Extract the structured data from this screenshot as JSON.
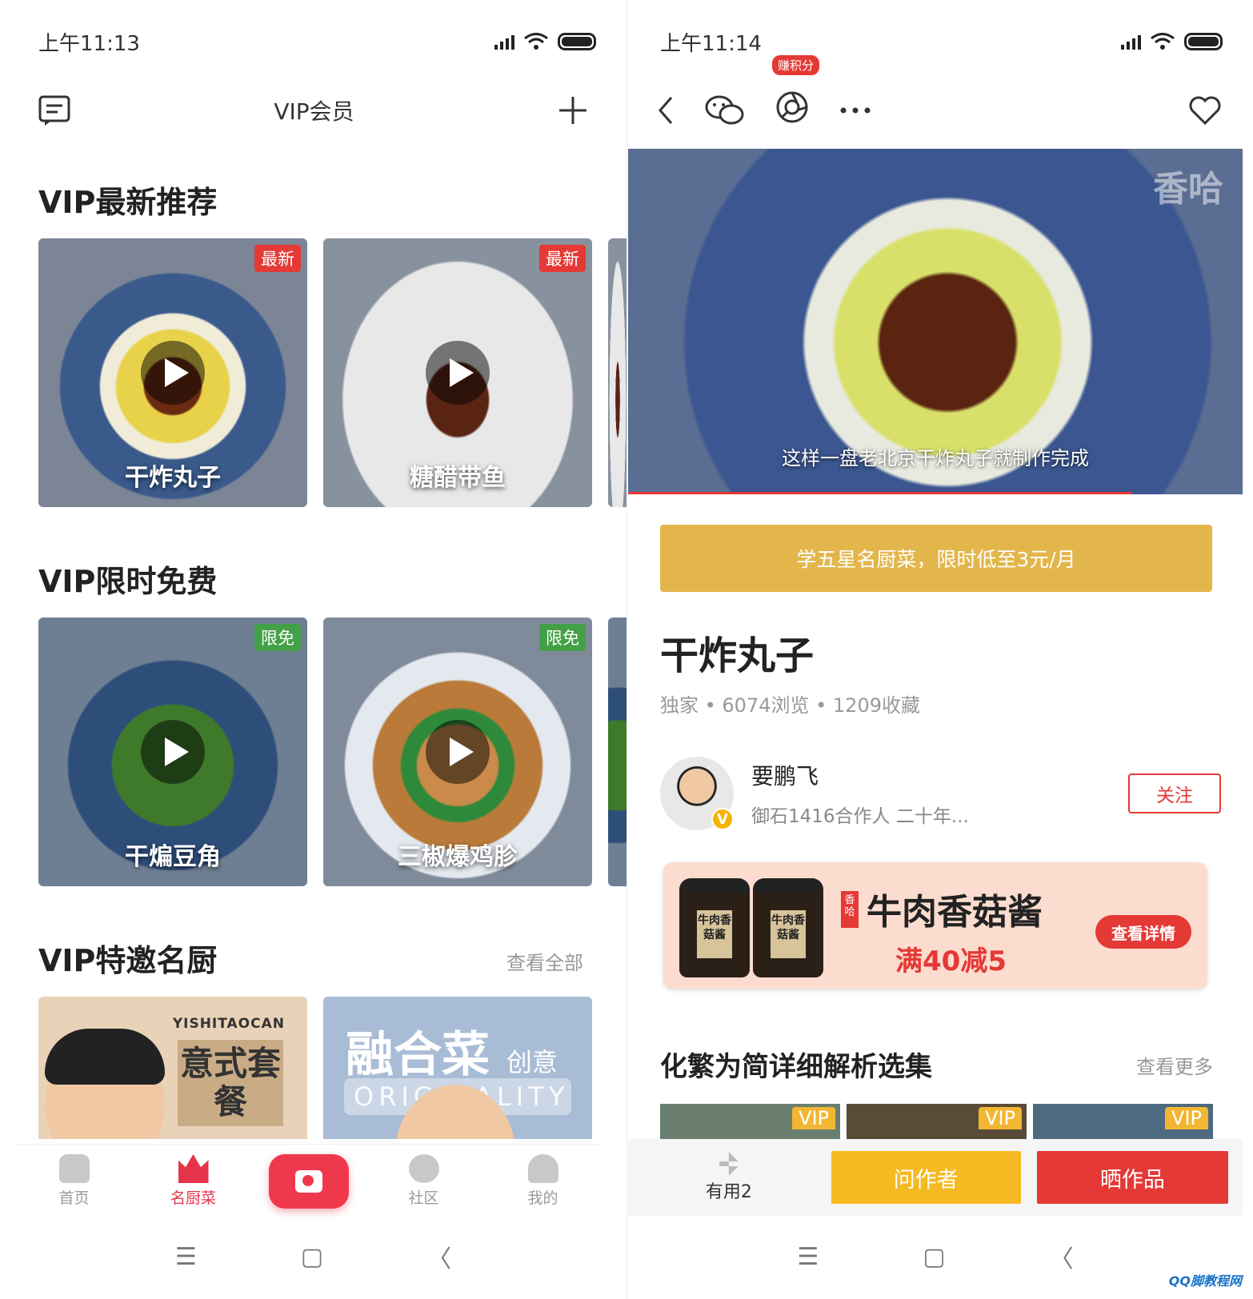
{
  "left": {
    "status": {
      "time": "上午11:13"
    },
    "header": {
      "title": "VIP会员",
      "menu_icon": "message-list-icon",
      "add_icon": "plus-icon"
    },
    "sections": {
      "latest": {
        "title": "VIP最新推荐",
        "cards": [
          {
            "name": "干炸丸子",
            "tag": "最新"
          },
          {
            "name": "糖醋带鱼",
            "tag": "最新"
          }
        ]
      },
      "free": {
        "title": "VIP限时免费",
        "cards": [
          {
            "name": "干煸豆角",
            "tag": "限免"
          },
          {
            "name": "三椒爆鸡胗",
            "tag": "限免"
          }
        ]
      },
      "chefs": {
        "title": "VIP特邀名厨",
        "see_all": "查看全部",
        "cards": [
          {
            "brand": "YISHITAOCAN",
            "big": "意式套餐"
          },
          {
            "big": "融合菜",
            "small": "创意",
            "sub": "ORIGINALITY"
          }
        ]
      }
    },
    "tabbar": [
      {
        "label": "首页",
        "icon": "home-icon"
      },
      {
        "label": "名厨菜",
        "icon": "crown-icon",
        "active": true
      },
      {
        "label": "",
        "icon": "camera-icon"
      },
      {
        "label": "社区",
        "icon": "community-icon"
      },
      {
        "label": "我的",
        "icon": "profile-icon"
      }
    ],
    "navbar": {
      "menu": "☰",
      "home": "▢",
      "back": "〈"
    }
  },
  "right": {
    "status": {
      "time": "上午11:14"
    },
    "toolbar": {
      "badge": "赚积分"
    },
    "video": {
      "watermark": "香哈",
      "caption": "这样一盘老北京干炸丸子就制作完成",
      "progress": 0.82
    },
    "promo": "学五星名厨菜，限时低至3元/月",
    "dish": {
      "title": "干炸丸子",
      "meta": "独家 • 6074浏览 • 1209收藏"
    },
    "author": {
      "name": "要鹏飞",
      "desc": "御石1416合作人 二十年...",
      "follow": "关注",
      "badge": "V"
    },
    "ad": {
      "brand": "香哈",
      "title": "牛肉香菇酱",
      "sub": "满40减5",
      "button": "查看详情",
      "jar_label_1": "牛肉香菇酱",
      "jar_label_2": "牛肉香菇酱"
    },
    "selection": {
      "title": "化繁为简详细解析选集",
      "more": "查看更多",
      "thumbs": [
        {
          "tag": "VIP"
        },
        {
          "tag": "VIP"
        },
        {
          "tag": "VIP"
        }
      ]
    },
    "bottom": {
      "useful": "有用2",
      "ask": "问作者",
      "show": "晒作品"
    },
    "navbar": {
      "menu": "☰",
      "home": "▢",
      "back": "〈"
    }
  },
  "watermark": "QQ脚教程网",
  "colors": {
    "accent_red": "#e53935",
    "gold": "#e3b64b",
    "yellow": "#f5b921",
    "tab_active": "#e5344a"
  }
}
